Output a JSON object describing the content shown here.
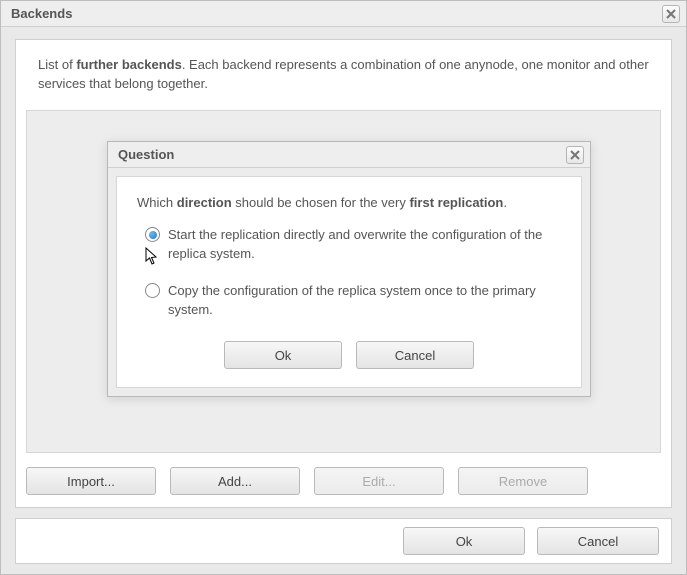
{
  "window": {
    "title": "Backends"
  },
  "description": {
    "prefix": "List of",
    "bold1": "further",
    "bold2": "backends",
    "rest": ". Each backend represents a combination of one anynode, one monitor and other services that belong together."
  },
  "buttons": {
    "import": "Import...",
    "add": "Add...",
    "edit": "Edit...",
    "remove": "Remove",
    "ok": "Ok",
    "cancel": "Cancel"
  },
  "modal": {
    "title": "Question",
    "question_prefix": "Which",
    "question_bold1": "direction",
    "question_mid": "should be chosen for the very",
    "question_bold2": "first replication",
    "question_end": ".",
    "option1": "Start the replication directly and overwrite the configuration of the replica system.",
    "option2": "Copy the configuration of the replica system once to the primary system.",
    "selected": 0,
    "ok": "Ok",
    "cancel": "Cancel"
  }
}
